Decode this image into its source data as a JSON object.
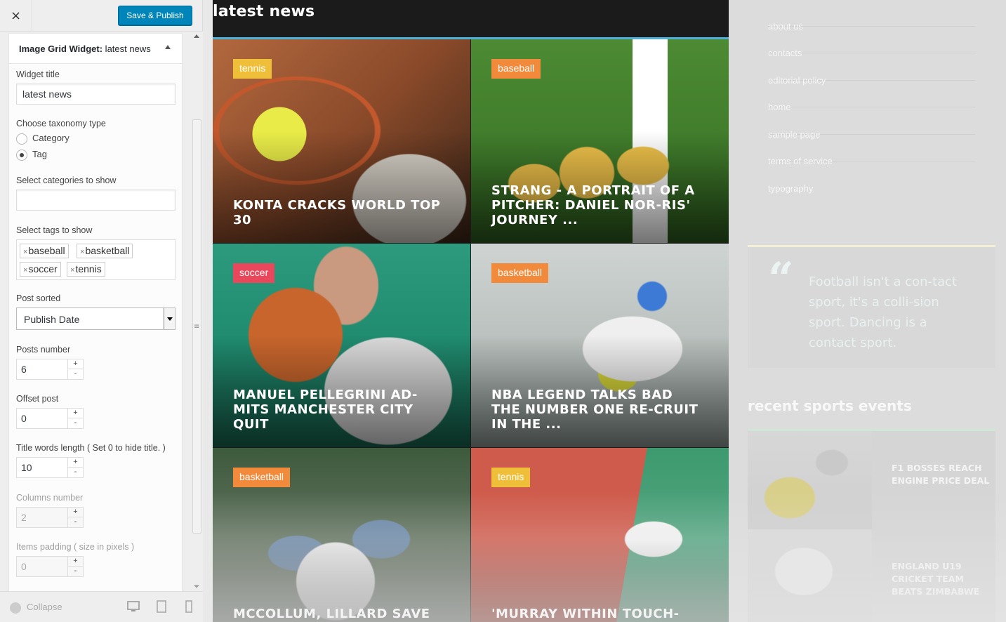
{
  "customizer": {
    "close_label": "×",
    "save_label": "Save & Publish",
    "widget_header_bold": "Image Grid Widget:",
    "widget_header_rest": " latest news",
    "widget_title_label": "Widget title",
    "widget_title_value": "latest news",
    "taxonomy_label": "Choose taxonomy type",
    "taxonomy_options": [
      "Category",
      "Tag"
    ],
    "taxonomy_selected": "Tag",
    "categories_label": "Select categories to show",
    "categories_value": "",
    "tags_label": "Select tags to show",
    "tags": [
      "baseball",
      "basketball",
      "soccer",
      "tennis"
    ],
    "sorted_label": "Post sorted",
    "sorted_value": "Publish Date",
    "posts_number_label": "Posts number",
    "posts_number_value": "6",
    "offset_label": "Offset post",
    "offset_value": "0",
    "title_words_label": "Title words length ( Set 0 to hide title. )",
    "title_words_value": "10",
    "columns_label": "Columns number",
    "columns_value": "2",
    "padding_label": "Items padding ( size in pixels )",
    "padding_value": "0",
    "spin_plus": "+",
    "spin_minus": "-",
    "collapse_label": "Collapse"
  },
  "preview": {
    "section_title": "latest news",
    "accent": "#4fb3d9",
    "tiles": [
      {
        "tag": "tennis",
        "tag_color": "#f0bf3a",
        "title": "KONTA CRACKS WORLD TOP 30"
      },
      {
        "tag": "baseball",
        "tag_color": "#f28a3c",
        "title": "STRANG - A PORTRAIT OF A PITCHER: DANIEL NOR-RIS' JOURNEY ..."
      },
      {
        "tag": "soccer",
        "tag_color": "#e8475c",
        "title": "MANUEL PELLEGRINI AD-MITS MANCHESTER CITY QUIT"
      },
      {
        "tag": "basketball",
        "tag_color": "#f28a3c",
        "title": "NBA LEGEND TALKS BAD THE NUMBER ONE RE-CRUIT IN THE ..."
      },
      {
        "tag": "basketball",
        "tag_color": "#f28a3c",
        "title": "MCCOLLUM, LILLARD SAVE BLAZERS PAST TIMBER-"
      },
      {
        "tag": "tennis",
        "tag_color": "#f0bf3a",
        "title": "'MURRAY WITHIN TOUCH-ING DISTANCE': TENNIS"
      }
    ]
  },
  "sidebar": {
    "menu": [
      "about us",
      "contacts",
      "editorial policy",
      "home",
      "sample page",
      "terms of service",
      "typography"
    ],
    "quote_mark": "“",
    "quote": "Football isn't a con-tact sport, it's a colli-sion sport. Dancing is a contact sport.",
    "events_title": "recent sports events",
    "events": [
      {
        "title": "F1 BOSSES REACH ENGINE PRICE DEAL"
      },
      {
        "title": "ENGLAND U19 CRICKET TEAM BEATS ZIMBABWE"
      }
    ]
  }
}
